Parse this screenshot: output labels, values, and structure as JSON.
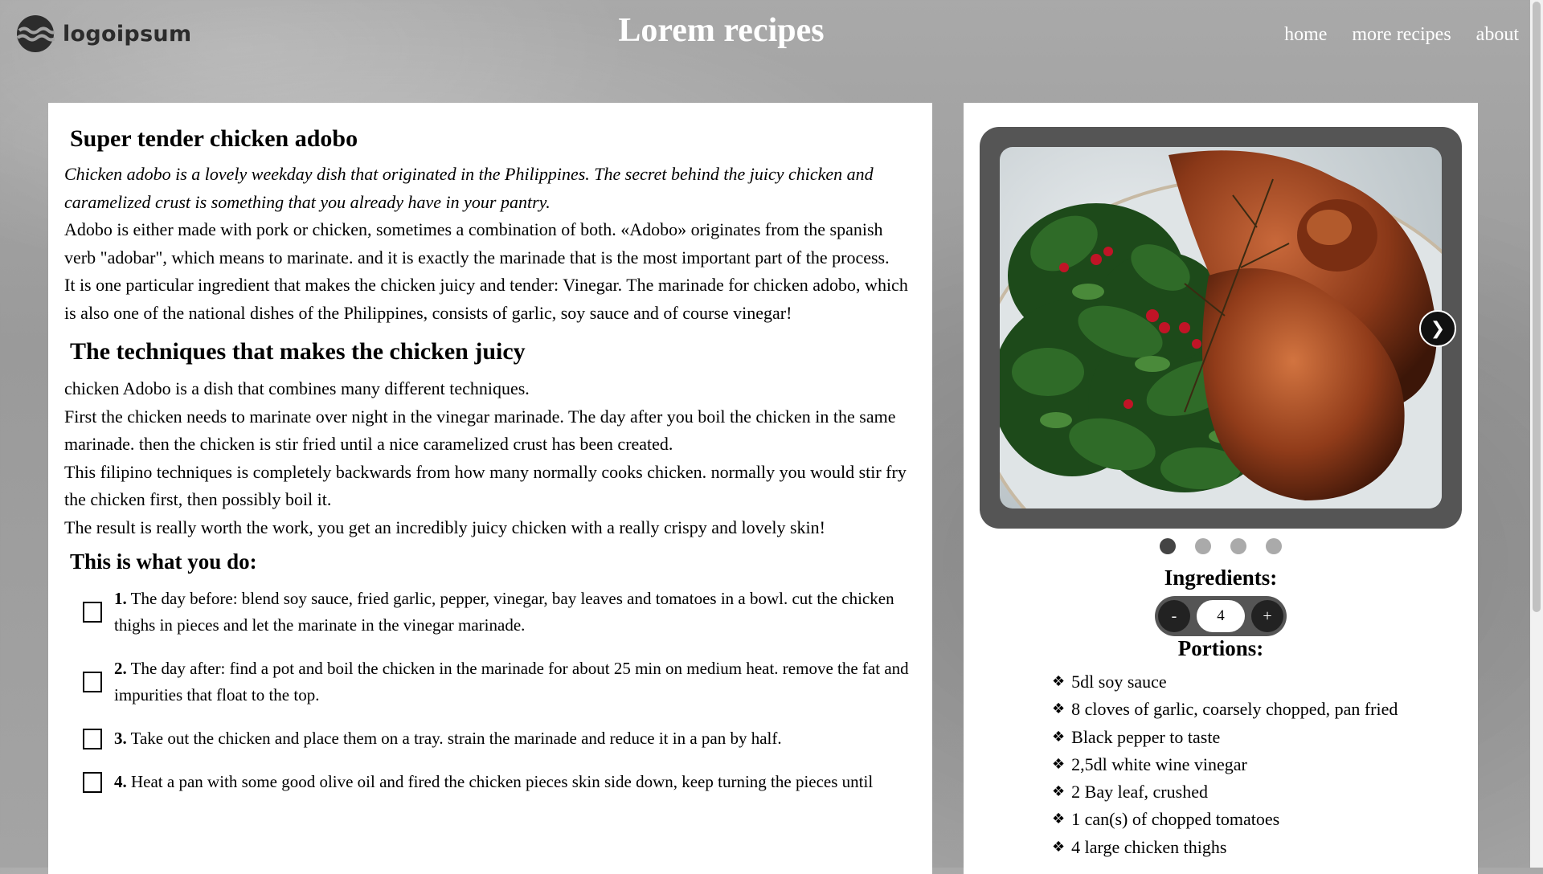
{
  "header": {
    "logo_text": "logoipsum",
    "site_title": "Lorem recipes",
    "nav": [
      "home",
      "more recipes",
      "about"
    ]
  },
  "article": {
    "title": "Super tender chicken adobo",
    "intro": "Chicken adobo is a lovely weekday dish that originated in the Philippines. The secret behind the juicy chicken and caramelized crust is something that you already have in your pantry.",
    "paragraphs": [
      "Adobo is either made with pork or chicken, sometimes a combination of both. «Adobo» originates from the spanish verb \"adobar\", which means to marinate. and it is exactly the marinade that is the most important part of the process.",
      "It is one particular ingredient that makes the chicken juicy and tender: Vinegar. The marinade for chicken adobo, which is also one of the national dishes of the Philippines, consists of garlic, soy sauce and of course vinegar!"
    ],
    "techniques_title": "The techniques that makes the chicken juicy",
    "techniques": [
      "chicken Adobo is a dish that combines many different techniques.",
      "First the chicken needs to marinate over night in the vinegar marinade. The day after you boil the chicken in the same marinade. then the chicken is stir fried until a nice caramelized crust has been created.",
      "This filipino techniques is completely backwards from how many normally cooks chicken. normally you would stir fry the chicken first, then possibly boil it.",
      "The result is really worth the work, you get an incredibly juicy chicken with a really crispy and lovely skin!"
    ],
    "steps_title": "This is what you do:",
    "steps": [
      {
        "num": "1.",
        "text": "The day before: blend soy sauce, fried garlic, pepper, vinegar, bay leaves and tomatoes in a bowl. cut the chicken thighs in pieces and let the marinate in the vinegar marinade."
      },
      {
        "num": "2.",
        "text": "The day after: find a pot and boil the chicken in the marinade for about 25 min on medium heat. remove the fat and impurities that float to the top."
      },
      {
        "num": "3.",
        "text": "Take out the chicken and place them on a tray. strain the marinade and reduce it in a pan by half."
      },
      {
        "num": "4.",
        "text": "Heat a pan with some good olive oil and fired the chicken pieces skin side down, keep turning the pieces until"
      }
    ]
  },
  "sidebar": {
    "carousel": {
      "slides": 4,
      "active": 0,
      "next_symbol": "❯"
    },
    "ingredients_title": "Ingredients:",
    "stepper": {
      "minus": "-",
      "value": "4",
      "plus": "+"
    },
    "portions_label": "Portions:",
    "bullet_symbol": "❖",
    "ingredients": [
      "5dl soy sauce",
      "8 cloves of garlic, coarsely chopped, pan fried",
      "Black pepper to taste",
      "2,5dl white wine vinegar",
      "2 Bay leaf, crushed",
      "1 can(s) of chopped tomatoes",
      "4 large chicken thighs"
    ]
  }
}
